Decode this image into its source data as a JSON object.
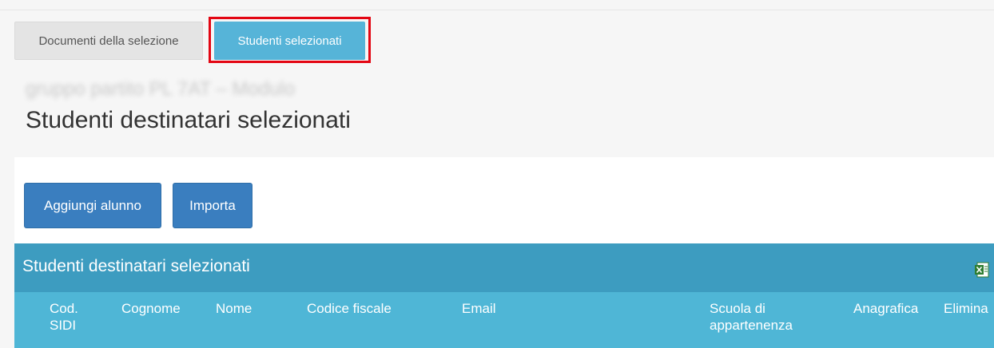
{
  "tabs": {
    "documents_label": "Documenti della selezione",
    "students_label": "Studenti selezionati"
  },
  "header": {
    "blurred_subtitle": "gruppo partito PL 7AT – Modulo",
    "title": "Studenti destinatari selezionati"
  },
  "toolbar": {
    "add_label": "Aggiungi alunno",
    "import_label": "Importa"
  },
  "table": {
    "title": "Studenti destinatari selezionati",
    "export_icon": "excel-icon",
    "columns": [
      "Cod. SIDI",
      "Cognome",
      "Nome",
      "Codice fiscale",
      "Email",
      "Scuola di appartenenza",
      "Anagrafica",
      "Elimina"
    ]
  },
  "colors": {
    "active_tab": "#56b4d8",
    "highlight": "#e30613",
    "button": "#3a7ebf",
    "table_header": "#3d9cc0",
    "column_header": "#4fb6d6"
  }
}
